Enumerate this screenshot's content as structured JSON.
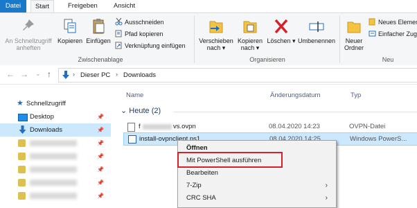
{
  "tabs": {
    "file": "Datei",
    "start": "Start",
    "share": "Freigeben",
    "view": "Ansicht"
  },
  "ribbon": {
    "pin": "An Schnellzugriff anheften",
    "copy": "Kopieren",
    "paste": "Einfügen",
    "cut": "Ausschneiden",
    "copy_path": "Pfad kopieren",
    "paste_shortcut": "Verknüpfung einfügen",
    "clipboard_label": "Zwischenablage",
    "move_to": "Verschieben nach",
    "copy_to": "Kopieren nach",
    "delete": "Löschen",
    "rename": "Umbenennen",
    "organize_label": "Organisieren",
    "new_folder": "Neuer Ordner",
    "new_item": "Neues Element",
    "easy_access": "Einfacher Zugriff",
    "new_label": "Neu",
    "colors": {
      "copy_blue": "#1f6fc5",
      "delete_red": "#d8202a",
      "folder_yellow": "#f5c342"
    }
  },
  "address": {
    "crumbs": [
      "Dieser PC",
      "Downloads"
    ]
  },
  "sidebar": {
    "quick_access": "Schnellzugriff",
    "desktop": "Desktop",
    "downloads": "Downloads"
  },
  "columns": {
    "name": "Name",
    "date": "Änderungsdatum",
    "type": "Typ"
  },
  "group": {
    "label": "Heute (2)"
  },
  "files": [
    {
      "name_prefix": "f",
      "name_suffix": "vs.ovpn",
      "date": "08.04.2020 14:23",
      "type": "OVPN-Datei"
    },
    {
      "name": "install-ovpnclient.ps1",
      "date": "08.04.2020 14:25",
      "type": "Windows PowerS..."
    }
  ],
  "context_menu": {
    "items": [
      "Öffnen",
      "Mit PowerShell ausführen",
      "Bearbeiten",
      "7-Zip",
      "CRC SHA"
    ],
    "highlight_color": "#d8202a"
  }
}
